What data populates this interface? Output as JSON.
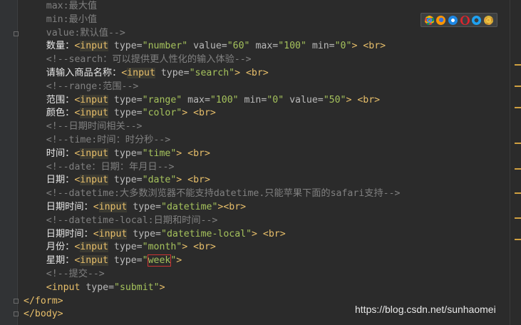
{
  "editor": {
    "lines": [
      {
        "segments": [
          {
            "cls": "cmt",
            "text": "    max:最大值"
          }
        ]
      },
      {
        "segments": [
          {
            "cls": "cmt",
            "text": "    min:最小值"
          }
        ]
      },
      {
        "segments": [
          {
            "cls": "cmt",
            "text": "    value:默认值-->"
          }
        ]
      },
      {
        "segments": [
          {
            "cls": "txt",
            "text": "    数量："
          },
          {
            "cls": "tag",
            "text": "<"
          },
          {
            "cls": "tagname",
            "text": "input"
          },
          {
            "cls": "attr",
            "text": " type="
          },
          {
            "cls": "val",
            "text": "\"number\""
          },
          {
            "cls": "attr",
            "text": " value="
          },
          {
            "cls": "val",
            "text": "\"60\""
          },
          {
            "cls": "attr",
            "text": " max="
          },
          {
            "cls": "val",
            "text": "\"100\""
          },
          {
            "cls": "attr",
            "text": " min="
          },
          {
            "cls": "val",
            "text": "\"0\""
          },
          {
            "cls": "tag",
            "text": "> <br>"
          }
        ]
      },
      {
        "segments": [
          {
            "cls": "cmt",
            "text": "    <!--search：可以提供更人性化的输入体验-->"
          }
        ]
      },
      {
        "segments": [
          {
            "cls": "txt",
            "text": "    请输入商品名称："
          },
          {
            "cls": "tag",
            "text": "<"
          },
          {
            "cls": "tagname",
            "text": "input"
          },
          {
            "cls": "attr",
            "text": " type="
          },
          {
            "cls": "val",
            "text": "\"search\""
          },
          {
            "cls": "tag",
            "text": "> <br>"
          }
        ]
      },
      {
        "segments": [
          {
            "cls": "cmt",
            "text": "    <!--range:范围-->"
          }
        ]
      },
      {
        "segments": [
          {
            "cls": "txt",
            "text": "    范围："
          },
          {
            "cls": "tag",
            "text": "<"
          },
          {
            "cls": "tagname",
            "text": "input"
          },
          {
            "cls": "attr",
            "text": " type="
          },
          {
            "cls": "val",
            "text": "\"range\""
          },
          {
            "cls": "attr",
            "text": " max="
          },
          {
            "cls": "val",
            "text": "\"100\""
          },
          {
            "cls": "attr",
            "text": " min="
          },
          {
            "cls": "val",
            "text": "\"0\""
          },
          {
            "cls": "attr",
            "text": " value="
          },
          {
            "cls": "val",
            "text": "\"50\""
          },
          {
            "cls": "tag",
            "text": "> <br>"
          }
        ]
      },
      {
        "segments": [
          {
            "cls": "txt",
            "text": "    颜色："
          },
          {
            "cls": "tag",
            "text": "<"
          },
          {
            "cls": "tagname",
            "text": "input"
          },
          {
            "cls": "attr",
            "text": " type="
          },
          {
            "cls": "val",
            "text": "\"color\""
          },
          {
            "cls": "tag",
            "text": "> <br>"
          }
        ]
      },
      {
        "segments": [
          {
            "cls": "cmt",
            "text": "    <!--日期时间相关-->"
          }
        ]
      },
      {
        "segments": [
          {
            "cls": "cmt",
            "text": "    <!--time:时间：时分秒-->"
          }
        ]
      },
      {
        "segments": [
          {
            "cls": "txt",
            "text": "    时间："
          },
          {
            "cls": "tag",
            "text": "<"
          },
          {
            "cls": "tagname",
            "text": "input"
          },
          {
            "cls": "attr",
            "text": " type="
          },
          {
            "cls": "val",
            "text": "\"time\""
          },
          {
            "cls": "tag",
            "text": "> <br>"
          }
        ]
      },
      {
        "segments": [
          {
            "cls": "cmt",
            "text": "    <!--date：日期：年月日-->"
          }
        ]
      },
      {
        "segments": [
          {
            "cls": "txt",
            "text": "    日期："
          },
          {
            "cls": "tag",
            "text": "<"
          },
          {
            "cls": "tagname",
            "text": "input"
          },
          {
            "cls": "attr",
            "text": " type="
          },
          {
            "cls": "val",
            "text": "\"date\""
          },
          {
            "cls": "tag",
            "text": "> <br>"
          }
        ]
      },
      {
        "segments": [
          {
            "cls": "cmt",
            "text": "    <!--datetime:大多数浏览器不能支持datetime.只能苹果下面的safari支持-->"
          }
        ]
      },
      {
        "segments": [
          {
            "cls": "txt",
            "text": "    日期时间："
          },
          {
            "cls": "tag",
            "text": "<"
          },
          {
            "cls": "tagname",
            "text": "input"
          },
          {
            "cls": "attr",
            "text": " type="
          },
          {
            "cls": "val",
            "text": "\"datetime\""
          },
          {
            "cls": "tag",
            "text": "><br>"
          }
        ]
      },
      {
        "segments": [
          {
            "cls": "cmt",
            "text": "    <!--datetime-local:日期和时间-->"
          }
        ]
      },
      {
        "segments": [
          {
            "cls": "txt",
            "text": "    日期时间："
          },
          {
            "cls": "tag",
            "text": "<"
          },
          {
            "cls": "tagname",
            "text": "input"
          },
          {
            "cls": "attr",
            "text": " type="
          },
          {
            "cls": "val",
            "text": "\"datetime-local\""
          },
          {
            "cls": "tag",
            "text": "> <br>"
          }
        ]
      },
      {
        "segments": [
          {
            "cls": "txt",
            "text": "    月份："
          },
          {
            "cls": "tag",
            "text": "<"
          },
          {
            "cls": "tagname",
            "text": "input"
          },
          {
            "cls": "attr",
            "text": " type="
          },
          {
            "cls": "val",
            "text": "\"month\""
          },
          {
            "cls": "tag",
            "text": "> <br>"
          }
        ]
      },
      {
        "segments": [
          {
            "cls": "txt",
            "text": "    星期："
          },
          {
            "cls": "tag",
            "text": "<"
          },
          {
            "cls": "tagname",
            "text": "input"
          },
          {
            "cls": "attr",
            "text": " type="
          },
          {
            "cls": "val",
            "text": "\""
          },
          {
            "cls": "val hl",
            "text": "week"
          },
          {
            "cls": "val",
            "text": "\""
          },
          {
            "cls": "tag",
            "text": ">"
          }
        ]
      },
      {
        "segments": [
          {
            "cls": "cmt",
            "text": "    <!--提交-->"
          }
        ]
      },
      {
        "segments": [
          {
            "cls": "tag",
            "text": "    <input"
          },
          {
            "cls": "attr",
            "text": " type="
          },
          {
            "cls": "val",
            "text": "\"submit\""
          },
          {
            "cls": "tag",
            "text": ">"
          }
        ]
      },
      {
        "segments": [
          {
            "cls": "tag",
            "text": "</form>"
          }
        ]
      },
      {
        "segments": [
          {
            "cls": "tag",
            "text": "</body>"
          }
        ]
      }
    ]
  },
  "browser_icons": [
    "chrome-icon",
    "firefox-icon",
    "safari-icon",
    "opera-icon",
    "ie-icon",
    "chrome-canary-icon"
  ],
  "colors": {
    "background": "#2b2b2b",
    "tag": "#e8bf6a",
    "attr_value": "#a5c25c",
    "comment": "#808080",
    "highlight_box": "#cc3333"
  },
  "watermark": "https://blog.csdn.net/sunhaomei"
}
